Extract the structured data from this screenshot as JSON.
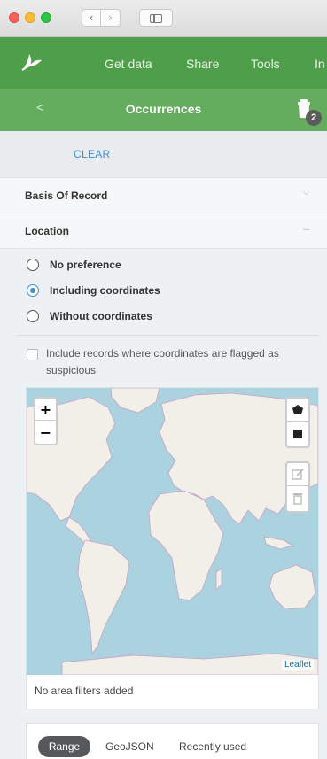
{
  "appbar": {
    "menu": [
      "Get data",
      "Share",
      "Tools",
      "In"
    ]
  },
  "subbar": {
    "back": "<",
    "title": "Occurrences",
    "badge": "2"
  },
  "filters": {
    "clear": "CLEAR",
    "sections": [
      "Basis Of Record",
      "Location"
    ]
  },
  "location": {
    "options": [
      "No preference",
      "Including coordinates",
      "Without coordinates"
    ],
    "selected": "Including coordinates",
    "suspicious_label": "Include records where coordinates are flagged as suspicious"
  },
  "map": {
    "zoom_in": "+",
    "zoom_out": "−",
    "attribution": "Leaflet",
    "area_message": "No area filters added"
  },
  "tabs": {
    "items": [
      "Range",
      "GeoJSON",
      "Recently used"
    ],
    "active": "Range"
  },
  "colors": {
    "header": "#4f9e4a",
    "subheader": "#64ad5f",
    "accent": "#3d8fd1",
    "water": "#aad3df",
    "land": "#f2efe9"
  },
  "icons": {
    "logo": "leaf-logo-icon",
    "bin": "bin-icon"
  }
}
